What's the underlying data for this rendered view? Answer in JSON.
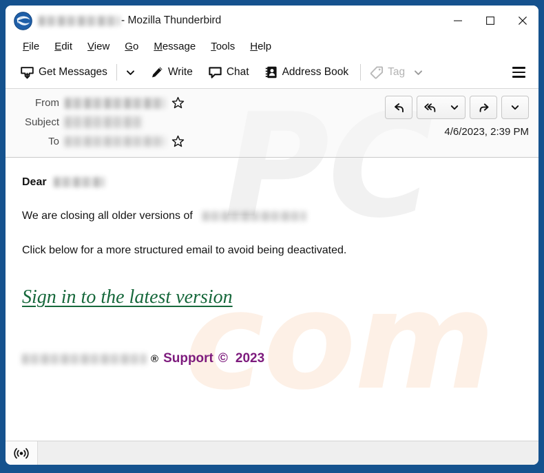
{
  "window": {
    "title_redacted": "",
    "title_suffix": " - Mozilla Thunderbird",
    "logo_icon": "thunderbird-logo-icon",
    "controls": {
      "minimize": "minimize-icon",
      "maximize": "maximize-icon",
      "close": "close-icon"
    },
    "frame_color": "#15528e"
  },
  "menubar": {
    "items": [
      {
        "label": "File",
        "accesskey": "F"
      },
      {
        "label": "Edit",
        "accesskey": "E"
      },
      {
        "label": "View",
        "accesskey": "V"
      },
      {
        "label": "Go",
        "accesskey": "G"
      },
      {
        "label": "Message",
        "accesskey": "M"
      },
      {
        "label": "Tools",
        "accesskey": "T"
      },
      {
        "label": "Help",
        "accesskey": "H"
      }
    ]
  },
  "toolbar": {
    "get_messages_label": "Get Messages",
    "get_messages_icon": "get-messages-icon",
    "get_messages_caret_icon": "chevron-down-icon",
    "write_label": "Write",
    "write_icon": "pencil-icon",
    "chat_label": "Chat",
    "chat_icon": "chat-bubble-icon",
    "address_book_label": "Address Book",
    "address_book_icon": "address-book-icon",
    "tag_label": "Tag",
    "tag_icon": "tag-icon",
    "tag_caret_icon": "chevron-down-icon",
    "tag_disabled": true,
    "app_menu_icon": "hamburger-menu-icon"
  },
  "message_header": {
    "from_label": "From",
    "from_value_redacted": "",
    "subject_label": "Subject",
    "subject_value_redacted": "",
    "to_label": "To",
    "to_value_redacted": "",
    "date": "4/6/2023, 2:39 PM",
    "star_icon": "star-outline-icon",
    "actions": [
      {
        "name": "reply",
        "icon": "reply-icon"
      },
      {
        "name": "reply-all",
        "icon": "reply-all-icon"
      },
      {
        "name": "reply-all-dropdown",
        "icon": "chevron-down-icon"
      },
      {
        "name": "forward",
        "icon": "forward-arrow-icon"
      },
      {
        "name": "more-dropdown",
        "icon": "chevron-down-icon"
      }
    ]
  },
  "message_body": {
    "greeting_prefix": "Dear",
    "greeting_name_redacted": "",
    "line1_prefix": "We are closing all older versions of",
    "line1_domain_redacted": "",
    "line2": "Click below for a more structured email to avoid being deactivated.",
    "phishing_link": "Sign in to the latest version",
    "link_color": "#16683b",
    "footer_domain_redacted": "",
    "footer_registered": "®",
    "footer_support": "Support",
    "footer_copyright": "©",
    "footer_year": "2023",
    "footer_color": "#7d1b7d"
  },
  "statusbar": {
    "connection_icon": "broadcast-signal-icon"
  },
  "watermark": {
    "part1": "PC",
    "part2": "com"
  }
}
